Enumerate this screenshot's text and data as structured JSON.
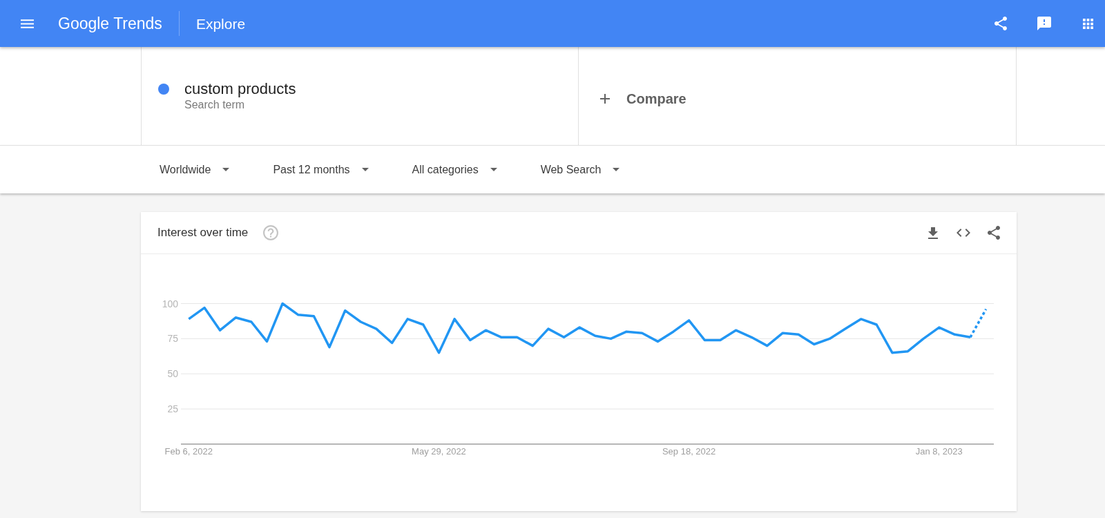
{
  "header": {
    "logo": "Google Trends",
    "title": "Explore"
  },
  "search_terms": [
    {
      "term": "custom products",
      "caption": "Search term",
      "color": "#4285f4"
    }
  ],
  "compare": {
    "label": "Compare"
  },
  "filters": [
    "Worldwide",
    "Past 12 months",
    "All categories",
    "Web Search"
  ],
  "card": {
    "title": "Interest over time",
    "chart_data": {
      "type": "line",
      "categories": [
        "Feb 6, 2022",
        null,
        null,
        null,
        null,
        null,
        null,
        null,
        null,
        null,
        null,
        null,
        null,
        null,
        null,
        null,
        "May 29, 2022",
        null,
        null,
        null,
        null,
        null,
        null,
        null,
        null,
        null,
        null,
        null,
        null,
        null,
        null,
        null,
        "Sep 18, 2022",
        null,
        null,
        null,
        null,
        null,
        null,
        null,
        null,
        null,
        null,
        null,
        null,
        null,
        null,
        null,
        "Jan 8, 2023",
        null,
        null,
        null
      ],
      "series": [
        {
          "color": "#2196f3",
          "values": [
            89,
            97,
            81,
            90,
            87,
            73,
            100,
            92,
            91,
            69,
            95,
            87,
            82,
            72,
            89,
            85,
            65,
            89,
            74,
            81,
            76,
            76,
            70,
            82,
            76,
            83,
            77,
            75,
            80,
            79,
            73,
            80,
            88,
            74,
            74,
            81,
            76,
            70,
            79,
            78,
            71,
            75,
            82,
            89,
            85,
            65,
            66,
            75,
            83,
            78,
            76,
            null
          ]
        },
        {
          "color": "#2196f3",
          "line_style": "dotted",
          "values": [
            null,
            null,
            null,
            null,
            null,
            null,
            null,
            null,
            null,
            null,
            null,
            null,
            null,
            null,
            null,
            null,
            null,
            null,
            null,
            null,
            null,
            null,
            null,
            null,
            null,
            null,
            null,
            null,
            null,
            null,
            null,
            null,
            null,
            null,
            null,
            null,
            null,
            null,
            null,
            null,
            null,
            null,
            null,
            null,
            null,
            null,
            null,
            null,
            null,
            null,
            76,
            96
          ]
        }
      ],
      "ylim": [
        0,
        100
      ],
      "yticks": [
        25,
        50,
        75,
        100
      ],
      "grid": true
    }
  }
}
